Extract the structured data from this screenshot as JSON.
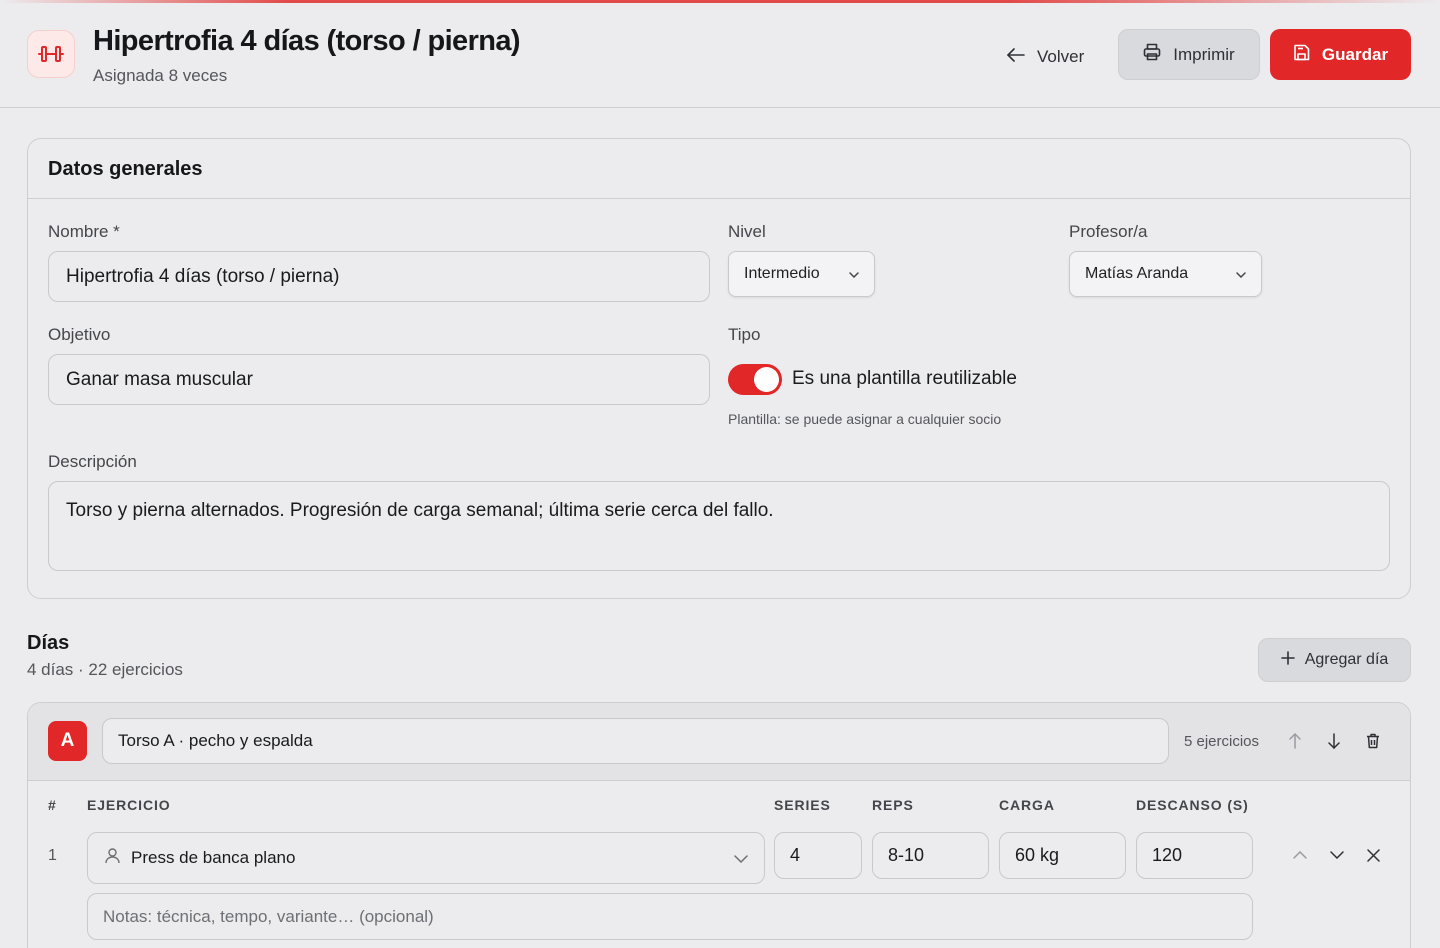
{
  "header": {
    "title": "Hipertrofia 4 días (torso / pierna)",
    "subtitle": "Asignada 8 veces",
    "back_label": "Volver",
    "print_label": "Imprimir",
    "save_label": "Guardar",
    "logo_icon": "dumbbell-icon",
    "accent_color": "#e12727"
  },
  "general": {
    "section_title": "Datos generales",
    "name_label": "Nombre *",
    "name_value": "Hipertrofia 4 días (torso / pierna)",
    "level_label": "Nivel",
    "level_value": "Intermedio",
    "trainer_label": "Profesor/a",
    "trainer_value": "Matías Aranda",
    "goal_label": "Objetivo",
    "goal_value": "Ganar masa muscular",
    "type_label": "Tipo",
    "template_toggle_label": "Es una plantilla reutilizable",
    "template_toggle_on": true,
    "template_hint": "Plantilla: se puede asignar a cualquier socio",
    "description_label": "Descripción",
    "description_value": "Torso y pierna alternados. Progresión de carga semanal; última serie cerca del fallo."
  },
  "days": {
    "title": "Días",
    "summary": "4 días · 22 ejercicios",
    "add_label": "Agregar día",
    "items": [
      {
        "badge": "A",
        "name": "Torso A · pecho y espalda",
        "exercise_count": "5 ejercicios",
        "columns": {
          "num": "#",
          "exercise": "EJERCICIO",
          "series": "SERIES",
          "reps": "REPS",
          "load": "CARGA",
          "rest": "DESCANSO (S)"
        },
        "rows": [
          {
            "num": "1",
            "exercise": "Press de banca plano",
            "series": "4",
            "reps": "8-10",
            "load": "60 kg",
            "rest": "120",
            "notes_placeholder": "Notas: técnica, tempo, variante… (opcional)"
          }
        ]
      }
    ]
  }
}
